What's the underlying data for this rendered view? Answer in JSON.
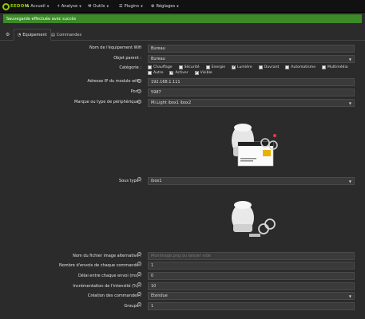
{
  "app": {
    "logo_text": "EEDOM"
  },
  "nav": {
    "items": [
      {
        "label": "Accueil",
        "icon": "home-icon"
      },
      {
        "label": "Analyse",
        "icon": "stethoscope-icon"
      },
      {
        "label": "Outils",
        "icon": "wrench-icon"
      },
      {
        "label": "Plugins",
        "icon": "tasks-icon"
      },
      {
        "label": "Réglages",
        "icon": "gears-icon"
      }
    ]
  },
  "banner": {
    "text": "Sauvegarde effectuée avec succès",
    "color": "#3c8b28"
  },
  "tabs": [
    {
      "label": "Equipement",
      "icon": "tachometer-icon",
      "active": true
    },
    {
      "label": "Commandes",
      "icon": "list-alt-icon",
      "active": false
    }
  ],
  "form": {
    "name": {
      "label": "Nom de l'équipement Wifi",
      "value": "Bureau"
    },
    "parent": {
      "label": "Objet parent :",
      "value": "Bureau"
    },
    "category": {
      "label": "Catégorie :",
      "options": [
        {
          "label": "Chauffage",
          "checked": false
        },
        {
          "label": "Sécurité",
          "checked": false
        },
        {
          "label": "Energie",
          "checked": false
        },
        {
          "label": "Lumière",
          "checked": true
        },
        {
          "label": "Ouvrant",
          "checked": false
        },
        {
          "label": "Automatisme",
          "checked": false
        },
        {
          "label": "Multimédia",
          "checked": false
        },
        {
          "label": "Autre",
          "checked": false
        }
      ]
    },
    "activate": {
      "label": "Activer",
      "checked": true
    },
    "visible": {
      "label": "Visible",
      "checked": true
    },
    "ip": {
      "label": "Adresse IP du module wifi :",
      "value": "192.168.1.111"
    },
    "port": {
      "label": "Port :",
      "value": "5987"
    },
    "device": {
      "label": "Marque ou type de périphérique :",
      "value": "Mi.Light ibox1 ibox2"
    },
    "subtype": {
      "label": "Sous type :",
      "value": "ibox1"
    },
    "alt_image": {
      "label": "Nom du fichier image alternative :",
      "placeholder": "Monimage.png ou laisser vide"
    },
    "sends": {
      "label": "Nombre d'envois de chaque commande :",
      "value": "1"
    },
    "delay": {
      "label": "Délai entre chaque envoi (ms) :",
      "value": "0"
    },
    "increment": {
      "label": "Incrémentation de l'intensité (%) :",
      "value": "10"
    },
    "creation": {
      "label": "Création des commandes :",
      "value": "Etendue"
    },
    "group": {
      "label": "Groupe :",
      "value": "1"
    }
  }
}
